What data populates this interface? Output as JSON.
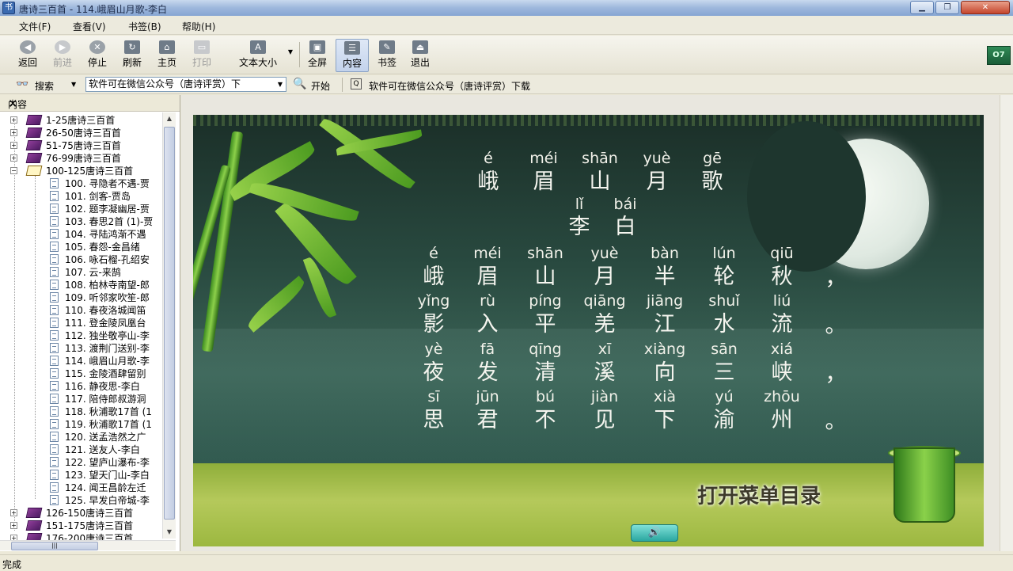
{
  "window": {
    "title": "唐诗三百首 - 114.峨眉山月歌-李白",
    "app_icon": "book-app-icon",
    "buttons": [
      "minimize",
      "maximize",
      "close"
    ]
  },
  "menu": [
    "文件(F)",
    "查看(V)",
    "书签(B)",
    "帮助(H)"
  ],
  "toolbar": {
    "back": "返回",
    "forward": "前进",
    "stop": "停止",
    "refresh": "刷新",
    "home": "主页",
    "print": "打印",
    "text_size": "文本大小",
    "fullscreen": "全屏",
    "contents": "内容",
    "bookmarks": "书签",
    "exit": "退出"
  },
  "searchbar": {
    "search_label": "搜索",
    "combo_value": "软件可在微信公众号（唐诗评赏）下",
    "go_label": "开始",
    "link_text": "软件可在微信公众号（唐诗评赏）下载"
  },
  "sidebar": {
    "title": "内容",
    "groups_top": [
      "1-25唐诗三百首",
      "26-50唐诗三百首",
      "51-75唐诗三百首",
      "76-99唐诗三百首"
    ],
    "open_group": "100-125唐诗三百首",
    "items": [
      "100. 寻隐者不遇-贾",
      "101. 剑客-贾岛",
      "102. 题李凝幽居-贾",
      "103. 春思2首 (1)-贾",
      "104. 寻陆鸿渐不遇",
      "105. 春怨-金昌绪",
      "106. 咏石榴-孔绍安",
      "107. 云-来鹄",
      "108. 柏林寺南望-郎",
      "109. 听邻家吹笙-郎",
      "110. 春夜洛城闻笛",
      "111. 登金陵凤凰台",
      "112. 独坐敬亭山-李",
      "113. 渡荆门送别-李",
      "114. 峨眉山月歌-李",
      "115. 金陵酒肆留别",
      "116. 静夜思-李白",
      "117. 陪侍郎叔游洞",
      "118. 秋浦歌17首 (1",
      "119. 秋浦歌17首 (1",
      "120. 送孟浩然之广",
      "121. 送友人-李白",
      "122. 望庐山瀑布-李",
      "123. 望天门山-李白",
      "124. 闻王昌龄左迁",
      "125. 早发白帝城-李"
    ],
    "groups_bottom": [
      "126-150唐诗三百首",
      "151-175唐诗三百首",
      "176-200唐诗三百首"
    ],
    "hscroll_thumb": "|||"
  },
  "poem": {
    "title_pinyin": [
      "é",
      "méi",
      "shān",
      "yuè",
      "gē"
    ],
    "title_chars": [
      "峨",
      "眉",
      "山",
      "月",
      "歌"
    ],
    "author_pinyin": [
      "lǐ",
      "bái"
    ],
    "author_chars": [
      "李",
      "白"
    ],
    "lines": [
      {
        "pinyin": [
          "é",
          "méi",
          "shān",
          "yuè",
          "bàn",
          "lún",
          "qiū"
        ],
        "chars": [
          "峨",
          "眉",
          "山",
          "月",
          "半",
          "轮",
          "秋"
        ],
        "punct": "，"
      },
      {
        "pinyin": [
          "yǐng",
          "rù",
          "píng",
          "qiāng",
          "jiāng",
          "shuǐ",
          "liú"
        ],
        "chars": [
          "影",
          "入",
          "平",
          "羌",
          "江",
          "水",
          "流"
        ],
        "punct": "。"
      },
      {
        "pinyin": [
          "yè",
          "fā",
          "qīng",
          "xī",
          "xiàng",
          "sān",
          "xiá"
        ],
        "chars": [
          "夜",
          "发",
          "清",
          "溪",
          "向",
          "三",
          "峡"
        ],
        "punct": "，"
      },
      {
        "pinyin": [
          "sī",
          "jūn",
          "bú",
          "jiàn",
          "xià",
          "yú",
          "zhōu"
        ],
        "chars": [
          "思",
          "君",
          "不",
          "见",
          "下",
          "渝",
          "州"
        ],
        "punct": "。"
      }
    ]
  },
  "open_menu_button": "打开菜单目录",
  "sound_icon": "speaker-icon",
  "status": "完成"
}
